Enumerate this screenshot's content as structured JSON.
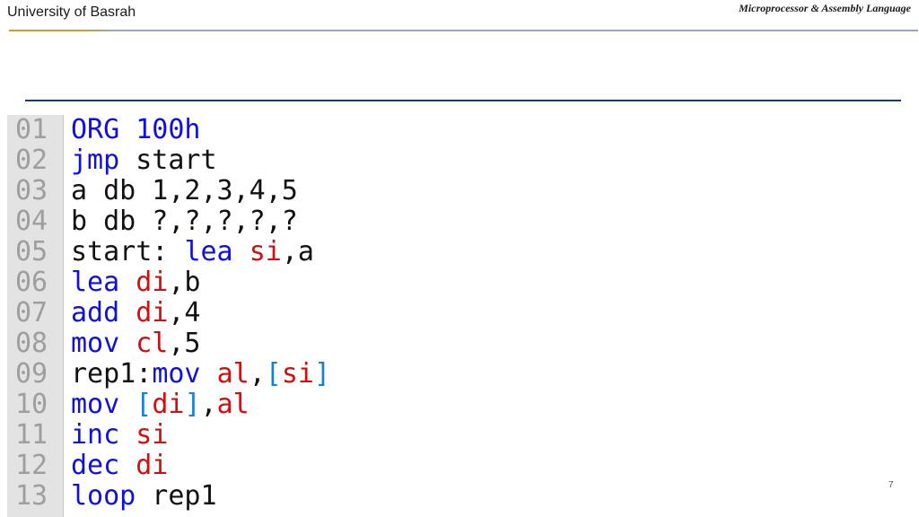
{
  "header": {
    "institution": "University of Basrah",
    "course": "Microprocessor & Assembly Language"
  },
  "code_lines": [
    {
      "num": "01",
      "tokens": [
        {
          "t": "ORG 100h",
          "k": "kw"
        }
      ]
    },
    {
      "num": "02",
      "tokens": [
        {
          "t": "jmp",
          "k": "kw"
        },
        {
          "t": " start",
          "k": "plain"
        }
      ]
    },
    {
      "num": "03",
      "tokens": [
        {
          "t": "a db 1,2,3,4,5",
          "k": "plain"
        }
      ]
    },
    {
      "num": "04",
      "tokens": [
        {
          "t": "b db ?,?,?,?,?",
          "k": "plain"
        }
      ]
    },
    {
      "num": "05",
      "tokens": [
        {
          "t": "start: ",
          "k": "plain"
        },
        {
          "t": "lea",
          "k": "kw"
        },
        {
          "t": " ",
          "k": "plain"
        },
        {
          "t": "si",
          "k": "reg"
        },
        {
          "t": ",a",
          "k": "plain"
        }
      ]
    },
    {
      "num": "06",
      "tokens": [
        {
          "t": "lea",
          "k": "kw"
        },
        {
          "t": " ",
          "k": "plain"
        },
        {
          "t": "di",
          "k": "reg"
        },
        {
          "t": ",b",
          "k": "plain"
        }
      ]
    },
    {
      "num": "07",
      "tokens": [
        {
          "t": "add",
          "k": "kw"
        },
        {
          "t": " ",
          "k": "plain"
        },
        {
          "t": "di",
          "k": "reg"
        },
        {
          "t": ",4",
          "k": "plain"
        }
      ]
    },
    {
      "num": "08",
      "tokens": [
        {
          "t": "mov",
          "k": "kw"
        },
        {
          "t": " ",
          "k": "plain"
        },
        {
          "t": "cl",
          "k": "reg"
        },
        {
          "t": ",5",
          "k": "plain"
        }
      ]
    },
    {
      "num": "09",
      "tokens": [
        {
          "t": "rep1:",
          "k": "plain"
        },
        {
          "t": "mov",
          "k": "kw"
        },
        {
          "t": " ",
          "k": "plain"
        },
        {
          "t": "al",
          "k": "reg"
        },
        {
          "t": ",",
          "k": "plain"
        },
        {
          "t": "[",
          "k": "br"
        },
        {
          "t": "si",
          "k": "reg"
        },
        {
          "t": "]",
          "k": "br"
        }
      ]
    },
    {
      "num": "10",
      "tokens": [
        {
          "t": "mov",
          "k": "kw"
        },
        {
          "t": " ",
          "k": "plain"
        },
        {
          "t": "[",
          "k": "br"
        },
        {
          "t": "di",
          "k": "reg"
        },
        {
          "t": "]",
          "k": "br"
        },
        {
          "t": ",",
          "k": "plain"
        },
        {
          "t": "al",
          "k": "reg"
        }
      ]
    },
    {
      "num": "11",
      "tokens": [
        {
          "t": "inc",
          "k": "kw"
        },
        {
          "t": " ",
          "k": "plain"
        },
        {
          "t": "si",
          "k": "reg"
        }
      ]
    },
    {
      "num": "12",
      "tokens": [
        {
          "t": "dec",
          "k": "kw"
        },
        {
          "t": " ",
          "k": "plain"
        },
        {
          "t": "di",
          "k": "reg"
        }
      ]
    },
    {
      "num": "13",
      "tokens": [
        {
          "t": "loop",
          "k": "kw"
        },
        {
          "t": " rep1",
          "k": "plain"
        }
      ]
    }
  ],
  "page_number": "7",
  "colors": {
    "keyword": "#1010dd",
    "register": "#cc1111",
    "bracket": "#1a7fd6",
    "line_number": "#9e9e9e",
    "gutter": "#e3e3e3"
  }
}
